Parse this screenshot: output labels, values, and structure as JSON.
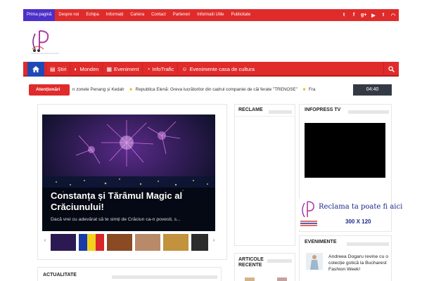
{
  "topnav": {
    "items": [
      "Prima pagină",
      "Despre noi",
      "Echipa",
      "Informații",
      "Cariera",
      "Contact",
      "Parteneri",
      "Informatii Utile",
      "Publicitate"
    ],
    "social": [
      "twitter-icon",
      "facebook-icon",
      "google-plus-icon",
      "youtube-icon",
      "tumblr-icon",
      "rss-icon"
    ]
  },
  "mainnav": {
    "items": [
      {
        "icon": "news-icon",
        "label": "Știri"
      },
      {
        "icon": "moon-icon",
        "label": "Monden"
      },
      {
        "icon": "calendar-icon",
        "label": "Eveniment"
      },
      {
        "icon": "traffic-icon",
        "label": "InfoTrafic"
      },
      {
        "icon": "theater-icon",
        "label": "Evenimente casa de cultura"
      }
    ]
  },
  "ticker": {
    "label": "Atenționări",
    "items": [
      "n zonele Penang și Kedah",
      "Republica Elenă: Greva lucrătorilor din cadrul companiei de căi ferate \"TRENOSE\"",
      "Fra"
    ],
    "time": "04:40"
  },
  "slider": {
    "title": "Constanța și Tărâmul Magic al Crăciunului!",
    "caption": "Dacă vrei cu adevărat să te simți de Crăciun ca-n povesti, s..."
  },
  "sections": {
    "actualitate": "ACTUALITATE",
    "reclame": "RECLAME",
    "infopress": "INFOPRESS TV",
    "articole": "ARTICOLE RECENTE",
    "eveniment": "EVENIMENTE"
  },
  "ad": {
    "text": "Reclama ta poate fi aici",
    "size": "300 X 120"
  },
  "eveniment": {
    "title": "Andreea Dogaru revine cu o colecție gotică la Bucharest Fashion Week!"
  },
  "colors": {
    "primary": "#e02b2b",
    "active": "#4d2fc9",
    "home": "#1f49b5"
  }
}
